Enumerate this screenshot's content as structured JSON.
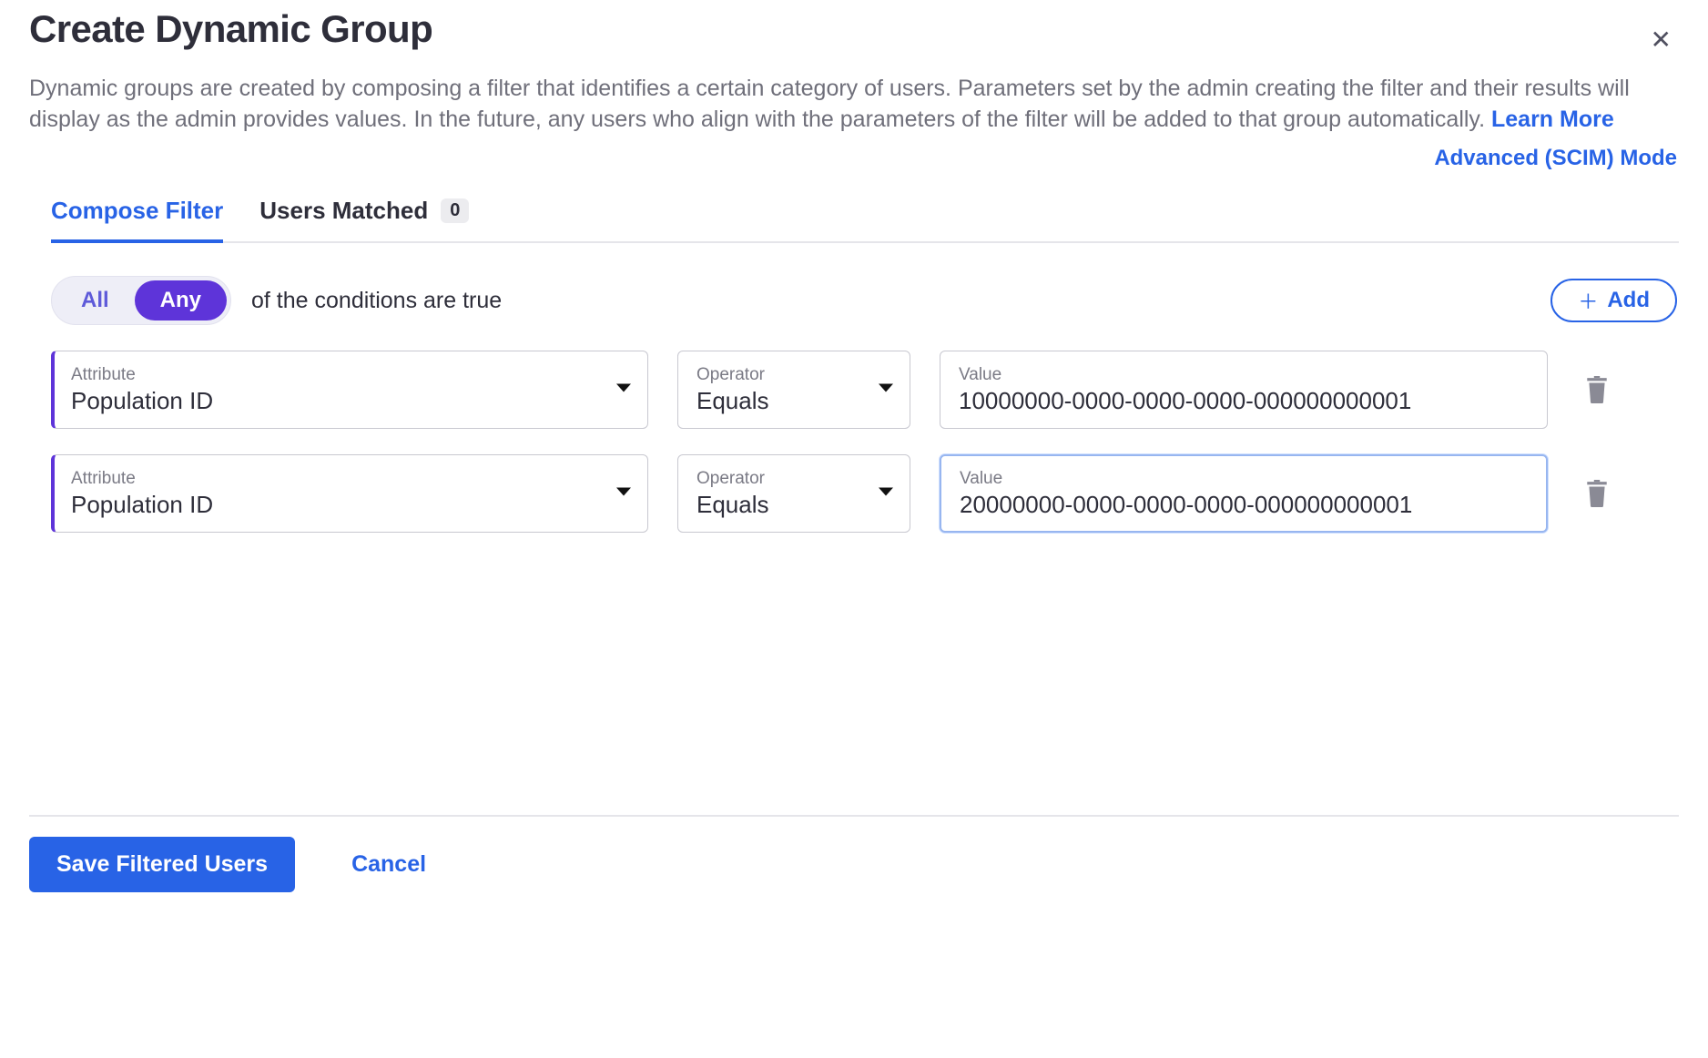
{
  "title": "Create Dynamic Group",
  "description": "Dynamic groups are created by composing a filter that identifies a certain category of users. Parameters set by the admin creating the filter and their results will display as the admin provides values. In the future, any users who align with the parameters of the filter will be added to that group automatically. ",
  "learn_more": "Learn More",
  "advanced_mode": "Advanced (SCIM) Mode",
  "tabs": {
    "compose": "Compose Filter",
    "matched": "Users Matched",
    "matched_count": "0"
  },
  "logic": {
    "all": "All",
    "any": "Any",
    "selected": "any",
    "suffix": "of the conditions are true"
  },
  "add_label": "Add",
  "labels": {
    "attribute": "Attribute",
    "operator": "Operator",
    "value": "Value"
  },
  "conditions": [
    {
      "attribute": "Population ID",
      "operator": "Equals",
      "value": "10000000-0000-0000-0000-000000000001",
      "focused": false
    },
    {
      "attribute": "Population ID",
      "operator": "Equals",
      "value": "20000000-0000-0000-0000-000000000001",
      "focused": true
    }
  ],
  "footer": {
    "save": "Save Filtered Users",
    "cancel": "Cancel"
  }
}
